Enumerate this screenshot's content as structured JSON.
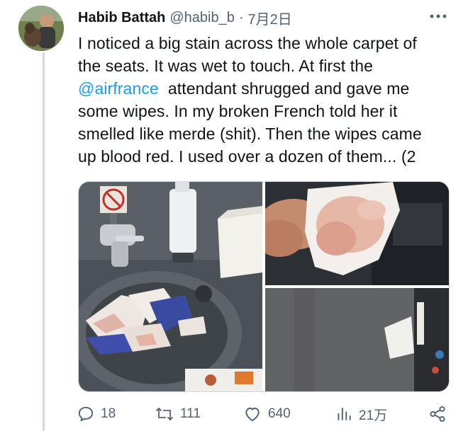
{
  "user": {
    "display_name": "Habib Battah",
    "handle": "@habib_b",
    "separator": "·",
    "date": "7月2日"
  },
  "tweet": {
    "lines": [
      "I noticed a big stain across the whole carpet of",
      "the seats. It was wet to touch. At first the",
      "attendant shrugged and gave me",
      "some wipes. In my broken French told her it",
      "smelled like merde (shit).  Then the wipes came",
      "up blood red. I used over a dozen of them... (2"
    ],
    "mention": "@airfrance"
  },
  "actions": {
    "replies": "18",
    "reposts": "111",
    "likes": "640",
    "views": "21万"
  },
  "icons": {
    "more": "more-horizontal-icon",
    "reply": "reply-icon",
    "repost": "repost-icon",
    "like": "heart-icon",
    "views": "analytics-icon",
    "share": "share-icon"
  },
  "colors": {
    "text": "#0f1419",
    "secondary": "#536471",
    "link": "#1d9bf0",
    "border": "#cfd9de"
  }
}
